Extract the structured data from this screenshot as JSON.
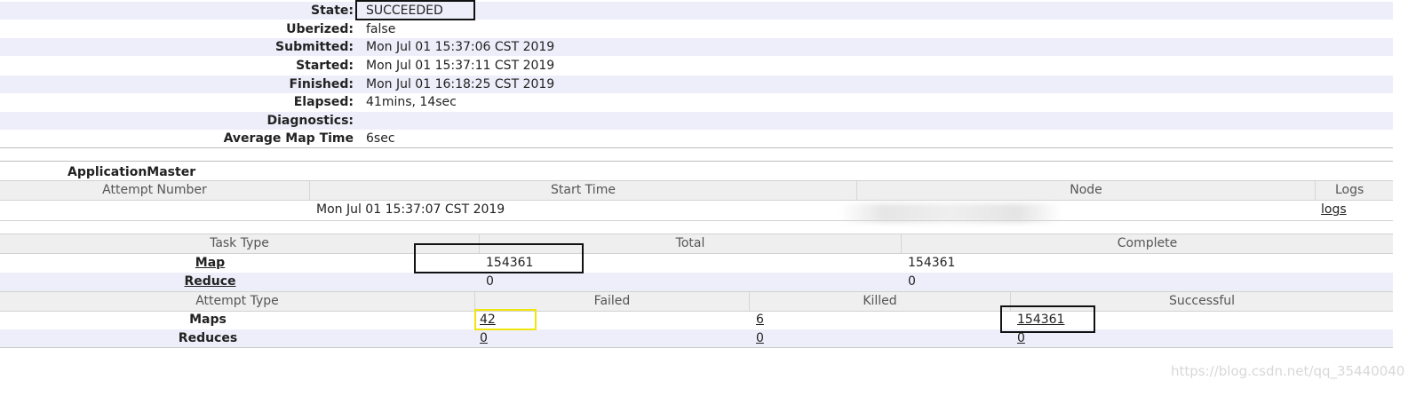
{
  "job_overview": {
    "rows": [
      {
        "label": "State:",
        "value": "SUCCEEDED"
      },
      {
        "label": "Uberized:",
        "value": "false"
      },
      {
        "label": "Submitted:",
        "value": "Mon Jul 01 15:37:06 CST 2019"
      },
      {
        "label": "Started:",
        "value": "Mon Jul 01 15:37:11 CST 2019"
      },
      {
        "label": "Finished:",
        "value": "Mon Jul 01 16:18:25 CST 2019"
      },
      {
        "label": "Elapsed:",
        "value": "41mins, 14sec"
      },
      {
        "label": "Diagnostics:",
        "value": ""
      },
      {
        "label": "Average Map Time",
        "value": "6sec"
      }
    ]
  },
  "application_master": {
    "title": "ApplicationMaster",
    "headers": [
      "Attempt Number",
      "Start Time",
      "Node",
      "Logs"
    ],
    "row": {
      "attempt_number": "",
      "start_time": "Mon Jul 01 15:37:07 CST 2019",
      "node": "",
      "logs": "logs"
    }
  },
  "tasks": {
    "headers": [
      "Task Type",
      "Total",
      "Complete"
    ],
    "rows": [
      {
        "type": "Map",
        "total": "154361",
        "complete": "154361"
      },
      {
        "type": "Reduce",
        "total": "0",
        "complete": "0"
      }
    ]
  },
  "attempts": {
    "headers": [
      "Attempt Type",
      "Failed",
      "Killed",
      "Successful"
    ],
    "rows": [
      {
        "type": "Maps",
        "failed": "42",
        "killed": "6",
        "successful": "154361"
      },
      {
        "type": "Reduces",
        "failed": "0",
        "killed": "0",
        "successful": "0"
      }
    ]
  },
  "watermark": "https://blog.csdn.net/qq_35440040"
}
